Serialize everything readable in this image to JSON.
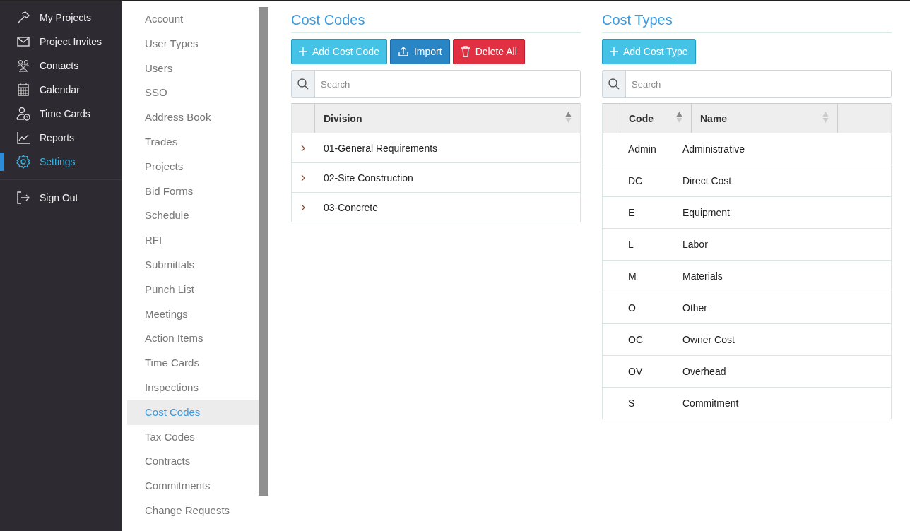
{
  "nav": {
    "items": [
      {
        "label": "My Projects",
        "selected": false
      },
      {
        "label": "Project Invites",
        "selected": false
      },
      {
        "label": "Contacts",
        "selected": false
      },
      {
        "label": "Calendar",
        "selected": false
      },
      {
        "label": "Time Cards",
        "selected": false
      },
      {
        "label": "Reports",
        "selected": false
      },
      {
        "label": "Settings",
        "selected": true
      }
    ],
    "footer_items": [
      {
        "label": "Sign Out",
        "selected": false
      }
    ]
  },
  "settings_menu": {
    "items": [
      {
        "label": "Account",
        "selected": false
      },
      {
        "label": "User Types",
        "selected": false
      },
      {
        "label": "Users",
        "selected": false
      },
      {
        "label": "SSO",
        "selected": false
      },
      {
        "label": "Address Book",
        "selected": false
      },
      {
        "label": "Trades",
        "selected": false
      },
      {
        "label": "Projects",
        "selected": false
      },
      {
        "label": "Bid Forms",
        "selected": false
      },
      {
        "label": "Schedule",
        "selected": false
      },
      {
        "label": "RFI",
        "selected": false
      },
      {
        "label": "Submittals",
        "selected": false
      },
      {
        "label": "Punch List",
        "selected": false
      },
      {
        "label": "Meetings",
        "selected": false
      },
      {
        "label": "Action Items",
        "selected": false
      },
      {
        "label": "Time Cards",
        "selected": false
      },
      {
        "label": "Inspections",
        "selected": false
      },
      {
        "label": "Cost Codes",
        "selected": true
      },
      {
        "label": "Tax Codes",
        "selected": false
      },
      {
        "label": "Contracts",
        "selected": false
      },
      {
        "label": "Commitments",
        "selected": false
      },
      {
        "label": "Change Requests",
        "selected": false
      }
    ]
  },
  "cost_codes": {
    "title": "Cost Codes",
    "buttons": [
      {
        "label": "Add Cost Code",
        "kind": "add"
      },
      {
        "label": "Import",
        "kind": "import"
      },
      {
        "label": "Delete All",
        "kind": "delete"
      }
    ],
    "search": {
      "placeholder": "Search"
    },
    "columns": [
      {
        "label": "Division",
        "sorted": true
      }
    ],
    "rows": [
      {
        "division": "01-General Requirements",
        "expanded": false
      },
      {
        "division": "02-Site Construction",
        "expanded": false
      },
      {
        "division": "03-Concrete",
        "expanded": false
      }
    ]
  },
  "cost_types": {
    "title": "Cost Types",
    "buttons": [
      {
        "label": "Add Cost Type",
        "kind": "add"
      }
    ],
    "search": {
      "placeholder": "Search"
    },
    "columns": [
      {
        "label": "Code",
        "sorted": true
      },
      {
        "label": "Name",
        "sorted": false
      }
    ],
    "rows": [
      {
        "code": "Admin",
        "name": "Administrative"
      },
      {
        "code": "DC",
        "name": "Direct Cost"
      },
      {
        "code": "E",
        "name": "Equipment"
      },
      {
        "code": "L",
        "name": "Labor"
      },
      {
        "code": "M",
        "name": "Materials"
      },
      {
        "code": "O",
        "name": "Other"
      },
      {
        "code": "OC",
        "name": "Owner Cost"
      },
      {
        "code": "OV",
        "name": "Overhead"
      },
      {
        "code": "S",
        "name": "Commitment"
      }
    ]
  }
}
